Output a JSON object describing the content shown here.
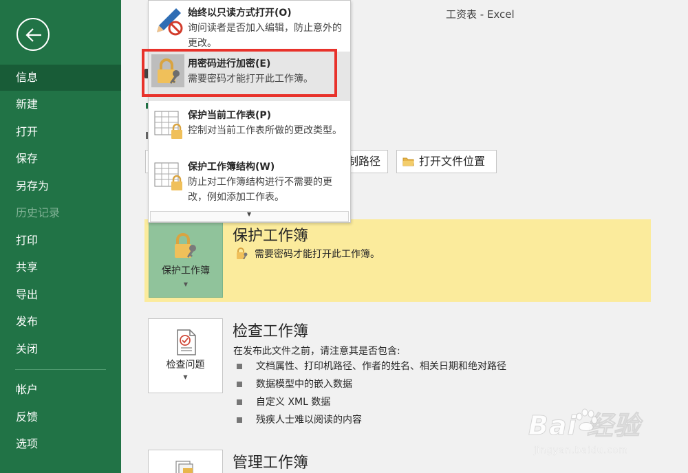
{
  "window": {
    "title": "工资表  -  Excel"
  },
  "nav": {
    "items": [
      {
        "label": "信息",
        "state": "active"
      },
      {
        "label": "新建",
        "state": "normal"
      },
      {
        "label": "打开",
        "state": "normal"
      },
      {
        "label": "保存",
        "state": "normal"
      },
      {
        "label": "另存为",
        "state": "normal"
      },
      {
        "label": "历史记录",
        "state": "disabled"
      },
      {
        "label": "打印",
        "state": "normal"
      },
      {
        "label": "共享",
        "state": "normal"
      },
      {
        "label": "导出",
        "state": "normal"
      },
      {
        "label": "发布",
        "state": "normal"
      },
      {
        "label": "关闭",
        "state": "normal"
      },
      {
        "label": "帐户",
        "state": "normal"
      },
      {
        "label": "反馈",
        "state": "normal"
      },
      {
        "label": "选项",
        "state": "normal"
      }
    ]
  },
  "dropdown": {
    "items": [
      {
        "title": "始终以只读方式打开(O)",
        "desc": "询问读者是否加入编辑，防止意外的更改。",
        "icon": "pencil-no-icon"
      },
      {
        "title": "用密码进行加密(E)",
        "desc": "需要密码才能打开此工作簿。",
        "icon": "lock-key-icon"
      },
      {
        "title": "保护当前工作表(P)",
        "desc": "控制对当前工作表所做的更改类型。",
        "icon": "sheet-lock-icon"
      },
      {
        "title": "保护工作簿结构(W)",
        "desc": "防止对工作簿结构进行不需要的更改，例如添加工作表。",
        "icon": "workbook-lock-icon"
      }
    ]
  },
  "toolbar_row": {
    "copy_path_partial": "制路径",
    "open_location": "打开文件位置"
  },
  "protect": {
    "tile_label": "保护工作簿",
    "heading": "保护工作簿",
    "desc": "需要密码才能打开此工作簿。"
  },
  "inspect": {
    "tile_label": "检查问题",
    "heading": "检查工作簿",
    "intro": "在发布此文件之前，请注意其是否包含:",
    "bullets": [
      "文档属性、打印机路径、作者的姓名、相关日期和绝对路径",
      "数据模型中的嵌入数据",
      "自定义 XML 数据",
      "残疾人士难以阅读的内容"
    ]
  },
  "manage": {
    "heading": "管理工作簿"
  },
  "watermark": {
    "brand": "Bai  经验",
    "url": "jingyan.baidu.com"
  },
  "colors": {
    "nav_bg": "#217346",
    "highlight": "#fbeb9c",
    "tile_selected": "#90c39b",
    "red_box": "#e8322b"
  }
}
